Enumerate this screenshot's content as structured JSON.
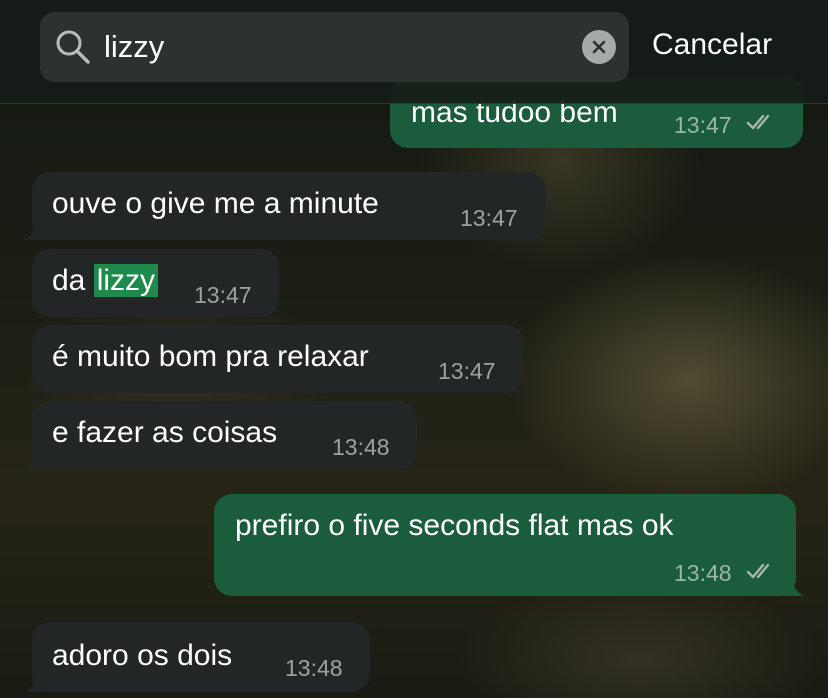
{
  "search": {
    "value": "lizzy",
    "cancel_label": "Cancelar"
  },
  "messages": [
    {
      "direction": "out",
      "text": "mas tudoo bem",
      "time": "13:47",
      "status": "read"
    },
    {
      "direction": "in",
      "text": "ouve o give me a minute",
      "time": "13:47"
    },
    {
      "direction": "in",
      "text_before": "da",
      "text_highlight": "lizzy",
      "time": "13:47"
    },
    {
      "direction": "in",
      "text": "é muito bom pra relaxar",
      "time": "13:47"
    },
    {
      "direction": "in",
      "text": "e fazer as coisas",
      "time": "13:48"
    },
    {
      "direction": "out",
      "text": "prefiro o five seconds flat mas ok",
      "time": "13:48",
      "status": "read"
    },
    {
      "direction": "in",
      "text": "adoro os dois",
      "time": "13:48"
    }
  ],
  "colors": {
    "incoming_bubble": "#232626",
    "outgoing_bubble": "#1a5c3c",
    "highlight": "#1e8a4c"
  },
  "icons": {
    "search": "search-icon",
    "clear": "clear-x-icon",
    "read_receipt": "double-check-icon"
  }
}
